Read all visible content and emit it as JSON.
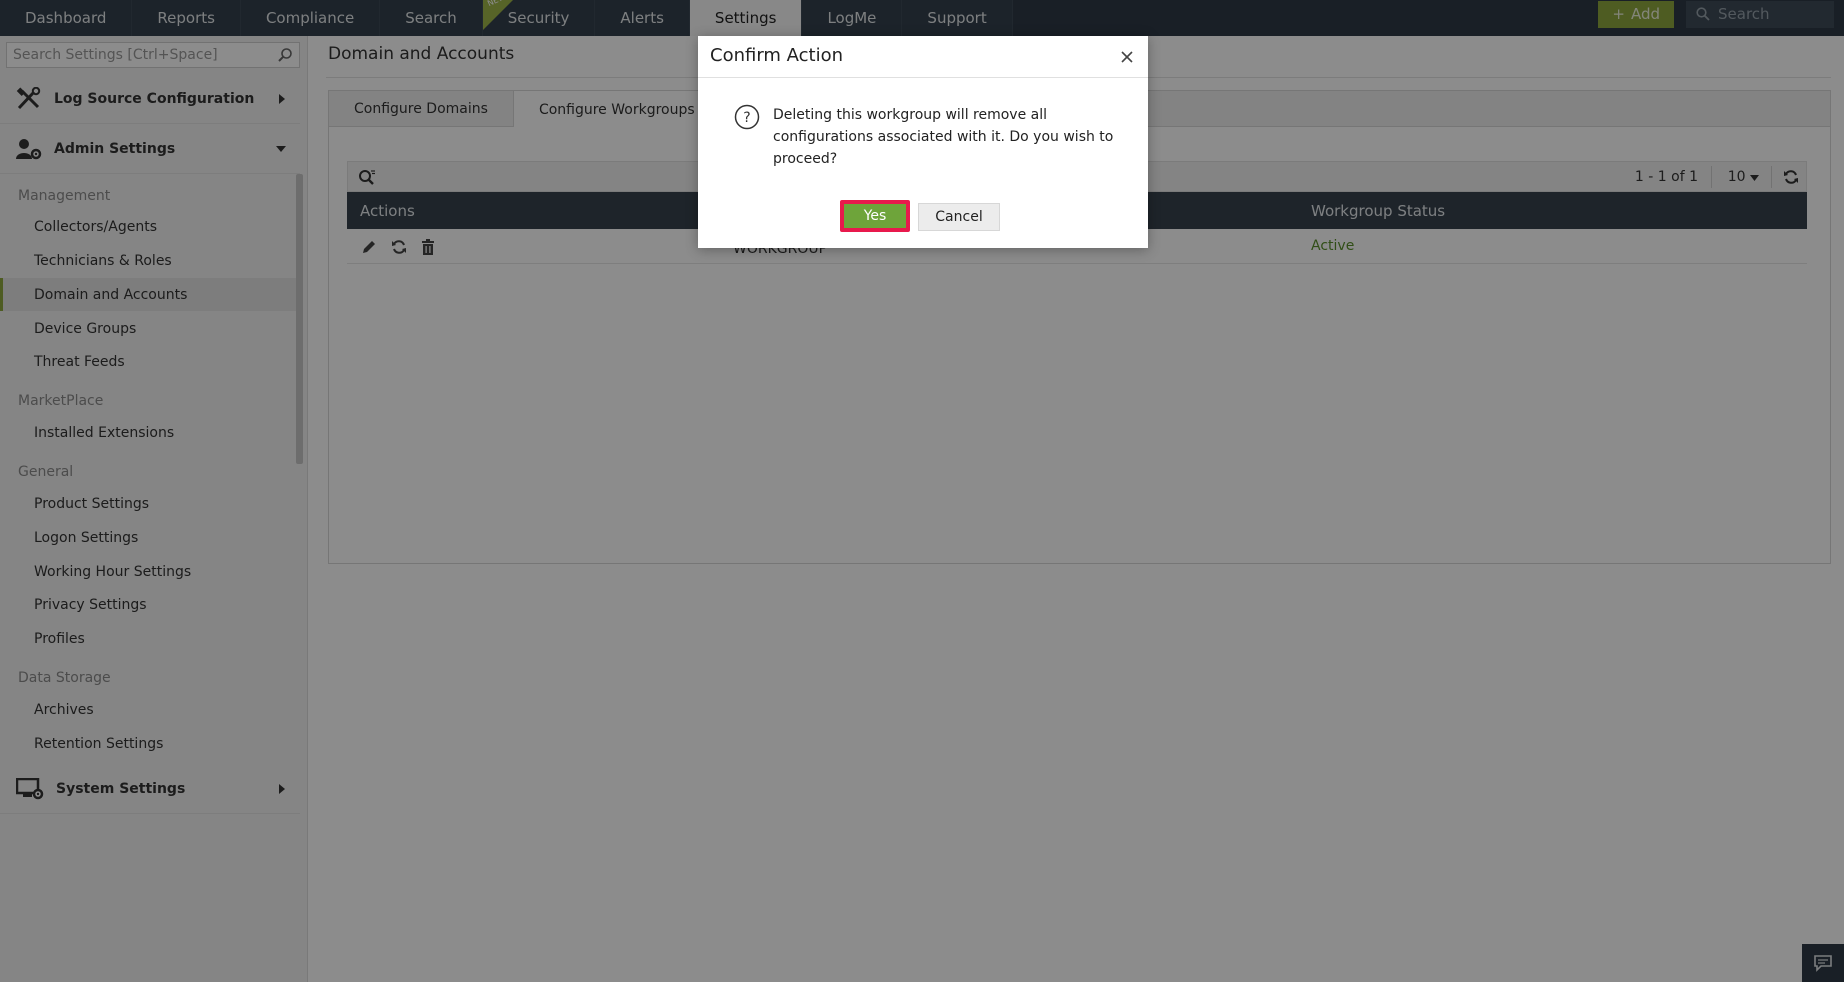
{
  "topnav": {
    "tabs": [
      "Dashboard",
      "Reports",
      "Compliance",
      "Search",
      "Security",
      "Alerts",
      "Settings",
      "LogMe",
      "Support"
    ],
    "new_badge": "NEW",
    "add_label": "Add",
    "search_placeholder": "Search"
  },
  "sidebar": {
    "search_placeholder": "Search Settings [Ctrl+Space]",
    "log_source": "Log Source Configuration",
    "admin_settings": "Admin Settings",
    "groups": {
      "management": "Management",
      "marketplace": "MarketPlace",
      "general": "General",
      "data_storage": "Data Storage"
    },
    "items": {
      "collectors": "Collectors/Agents",
      "technicians": "Technicians & Roles",
      "domain": "Domain and Accounts",
      "device_groups": "Device Groups",
      "threat_feeds": "Threat Feeds",
      "installed_ext": "Installed Extensions",
      "product_settings": "Product Settings",
      "logon_settings": "Logon Settings",
      "working_hour": "Working Hour Settings",
      "privacy": "Privacy Settings",
      "profiles": "Profiles",
      "archives": "Archives",
      "retention": "Retention Settings"
    },
    "system_settings": "System Settings"
  },
  "main": {
    "title": "Domain and Accounts",
    "tabs": [
      "Configure Domains",
      "Configure Workgroups"
    ],
    "pager": "1 - 1 of 1",
    "per_page": "10",
    "columns": {
      "actions": "Actions",
      "status": "Workgroup Status"
    },
    "row": {
      "name": "WORKGROUP",
      "status": "Active"
    }
  },
  "dialog": {
    "title": "Confirm Action",
    "message": "Deleting this workgroup will remove all configurations associated with it. Do you wish to proceed?",
    "yes": "Yes",
    "cancel": "Cancel"
  },
  "colors": {
    "nav_bg": "#2e3a45",
    "accent_green": "#8fa83e",
    "yes_green": "#6ea43a",
    "highlight_red": "#e8194c",
    "status_green": "#5a8f2a"
  }
}
